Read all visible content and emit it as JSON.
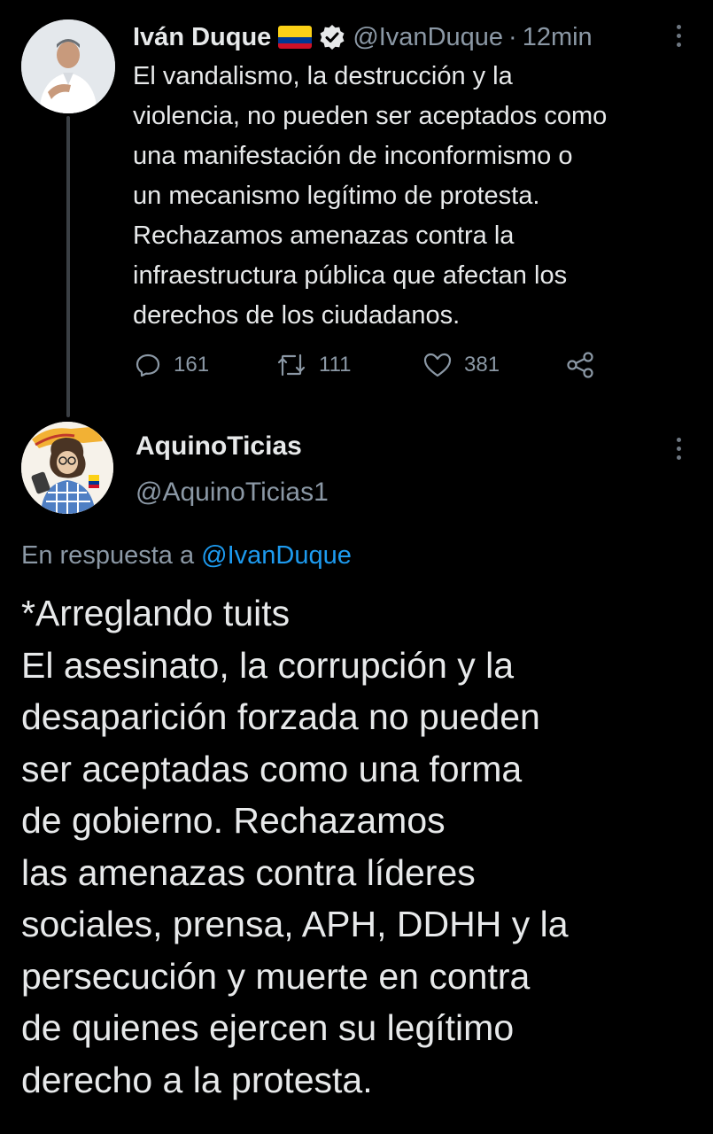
{
  "colors": {
    "background": "#000000",
    "text": "#e7e9ea",
    "muted": "#8b98a5",
    "link": "#1d9bf0",
    "thread_line": "#3a3f44",
    "flag": [
      "#fcd116",
      "#003893",
      "#ce1126"
    ]
  },
  "parent_tweet": {
    "author_name": "Iván Duque",
    "flag_icon": "colombia-flag-icon",
    "verified_icon": "verified-badge-icon",
    "handle": "@IvanDuque",
    "separator": "·",
    "time": "12min",
    "text": "El vandalismo, la destrucción y la\nviolencia, no pueden ser aceptados como\nuna manifestación de inconformismo o\nun mecanismo legítimo de protesta.\nRechazamos amenazas contra la\ninfraestructura pública que afectan los\nderechos de los ciudadanos.",
    "stats": {
      "replies": "161",
      "retweets": "111",
      "likes": "381"
    }
  },
  "reply_tweet": {
    "author_name": "AquinoTicias",
    "handle": "@AquinoTicias1",
    "replying_label": "En respuesta a",
    "replying_to": "@IvanDuque",
    "text": "*Arreglando tuits\nEl asesinato, la corrupción y la\ndesaparición forzada no pueden\nser aceptadas como una forma\nde gobierno. Rechazamos\nlas amenazas contra líderes\nsociales, prensa, APH, DDHH y la\npersecución y muerte en contra\nde quienes ejercen su legítimo\nderecho a la protesta."
  }
}
